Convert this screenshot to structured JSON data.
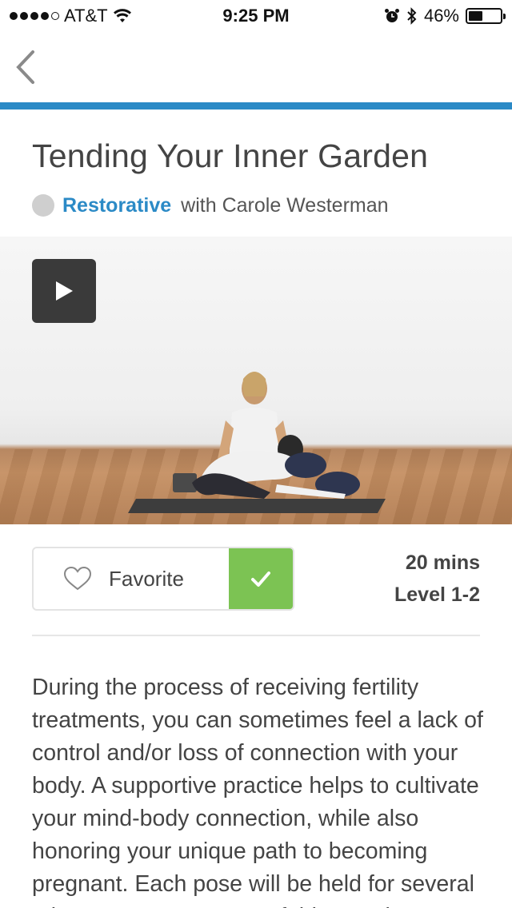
{
  "status_bar": {
    "carrier": "AT&T",
    "time": "9:25 PM",
    "battery_percent": "46%",
    "battery_level": 0.46,
    "icons": [
      "signal-dots-icon",
      "wifi-icon",
      "alarm-icon",
      "bluetooth-icon",
      "battery-icon"
    ]
  },
  "nav": {
    "back_icon": "chevron-left-icon",
    "accent_color": "#2b8ac6"
  },
  "class": {
    "title": "Tending Your Inner Garden",
    "style": "Restorative",
    "instructor": "with Carole Westerman",
    "duration": "20 mins",
    "level": "Level 1-2",
    "description": "During the process of receiving fertility treatments, you can sometimes feel a lack of control and/or loss of connection with your body. A supportive practice helps to cultivate your mind-body connection, while also honoring your unique path to becoming pregnant. Each pose will be held for several minutes. To get a taste of this practice, try"
  },
  "video": {
    "play_icon": "play-icon"
  },
  "actions": {
    "favorite_label": "Favorite",
    "favorite_icon": "heart-outline-icon",
    "check_icon": "checkmark-icon",
    "check_color": "#7cc353"
  }
}
